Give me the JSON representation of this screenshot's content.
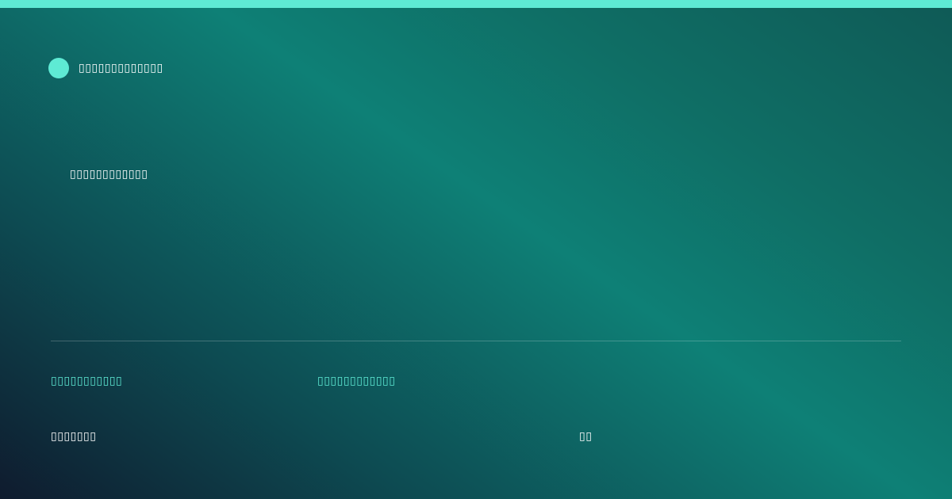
{
  "colors": {
    "accent": "#5eead4",
    "text": "#ffffff"
  },
  "header": {
    "brand_name": "▯▯▯▯▯▯▯▯▯▯▯▯▯"
  },
  "main": {
    "headline": "▯▯▯▯▯▯▯▯▯▯▯▯"
  },
  "meta": {
    "left": "▯▯▯▯▯▯▯▯▯▯▯",
    "middle": "▯▯▯▯▯▯▯▯▯▯▯▯"
  },
  "footer": {
    "left": "▯▯▯▯▯▯▯",
    "right": "▯▯"
  }
}
